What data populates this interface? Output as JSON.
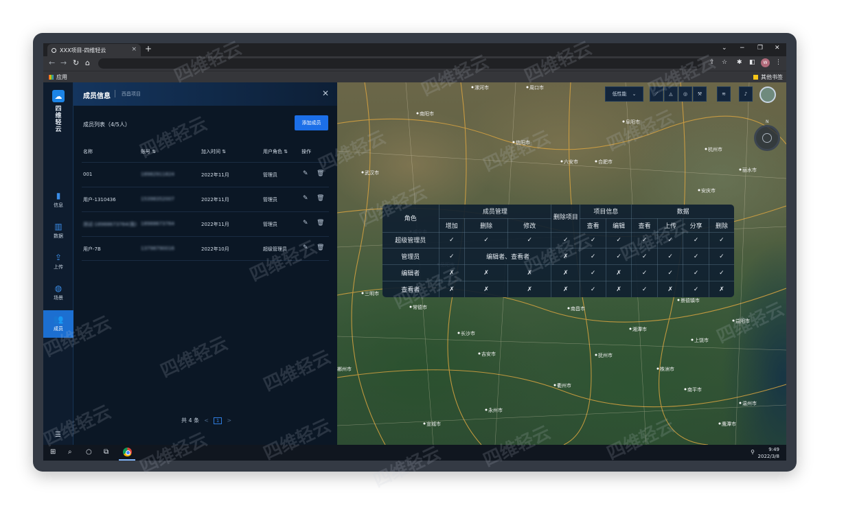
{
  "browser": {
    "tab_title": "XXX项目-四维轻云",
    "tab_close": "×",
    "new_tab": "+",
    "bookmark_apps": "应用",
    "bookmark_other": "其他书签",
    "profile_initials": "W"
  },
  "sidebar": {
    "brand": "四维轻云",
    "items": [
      {
        "label": "信息",
        "icon": "document-icon"
      },
      {
        "label": "数据",
        "icon": "data-icon"
      },
      {
        "label": "上传",
        "icon": "upload-icon"
      },
      {
        "label": "场景",
        "icon": "scene-icon"
      },
      {
        "label": "成员",
        "icon": "members-icon"
      }
    ],
    "active": "成员"
  },
  "panel": {
    "title": "成员信息",
    "subtitle": "西昌项目",
    "list_title": "成员列表（4/5人）",
    "add_button": "添加成员",
    "columns": [
      "名称",
      "账号 ⇅",
      "加入时间 ⇅",
      "用户角色 ⇅",
      "操作"
    ],
    "rows": [
      {
        "name": "001",
        "account": "18982911824",
        "joined": "2022年11月",
        "role": "管理员"
      },
      {
        "name": "用户-1310436",
        "account": "15398352007",
        "joined": "2022年11月",
        "role": "管理员"
      },
      {
        "name": "测试-18988673764(我)",
        "account": "18988673764",
        "joined": "2022年11月",
        "role": "管理员"
      },
      {
        "name": "用户-7B",
        "account": "13798790016",
        "joined": "2022年10月",
        "role": "超级管理员"
      }
    ],
    "pagination": {
      "total": "共 4 条",
      "page": "1",
      "prev": "<",
      "next": ">"
    }
  },
  "map": {
    "quality_select": "低性能",
    "compass_n": "N",
    "permission_table": {
      "role_header": "角色",
      "groups": [
        {
          "name": "成员管理",
          "cols": [
            "增加",
            "删除",
            "修改"
          ]
        },
        {
          "name": "删除项目",
          "cols": []
        },
        {
          "name": "项目信息",
          "cols": [
            "查看",
            "编辑"
          ]
        },
        {
          "name": "数据",
          "cols": [
            "查看",
            "上传",
            "分享",
            "删除"
          ]
        }
      ],
      "rows": [
        {
          "role": "超级管理员",
          "cells": [
            "✓",
            "✓",
            "✓",
            "✓",
            "✓",
            "✓",
            "✓",
            "✓",
            "✓",
            "✓"
          ]
        },
        {
          "role": "管理员",
          "note": "编辑者、查看者",
          "cells": [
            "✓",
            "✗",
            "✓",
            "✓",
            "✓",
            "✓",
            "✓",
            "✓"
          ]
        },
        {
          "role": "编辑者",
          "cells": [
            "✗",
            "✗",
            "✗",
            "✗",
            "✓",
            "✗",
            "✓",
            "✓",
            "✓",
            "✓"
          ]
        },
        {
          "role": "查看者",
          "cells": [
            "✗",
            "✗",
            "✗",
            "✗",
            "✓",
            "✗",
            "✓",
            "✗",
            "✓",
            "✗"
          ]
        }
      ]
    },
    "places": [
      "漯河市",
      "周口市",
      "南阳市",
      "信阳市",
      "阜阳市",
      "六安市",
      "合肥市",
      "安庆市",
      "武汉市",
      "咸宁市",
      "岳阳市",
      "南昌市",
      "长沙市",
      "湘潭市",
      "景德镇市",
      "上饶市",
      "抚州市",
      "衢州市",
      "吉安市",
      "株洲市",
      "南平市",
      "三明市",
      "常德市",
      "益阳市",
      "鹰潭市",
      "温州市",
      "丽水市",
      "杭州市",
      "宣城市",
      "永州市",
      "郴州市"
    ]
  },
  "watermark": "四维轻云",
  "taskbar": {
    "time": "9:49",
    "date": "2022/3/8"
  },
  "colors": {
    "accent": "#1c6fe8",
    "yes": "#2ed37a",
    "no": "#ef3a3a",
    "sidebar_bg": "#0e1c2e"
  }
}
